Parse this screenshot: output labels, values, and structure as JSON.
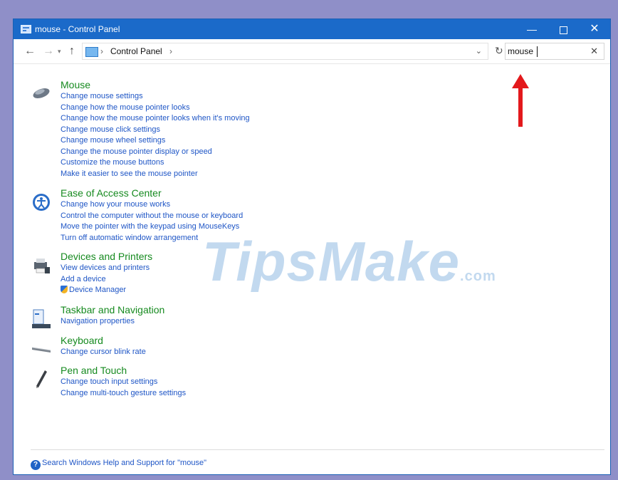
{
  "window": {
    "title": "mouse - Control Panel",
    "controls": {
      "minimize": "—",
      "close": "✕"
    }
  },
  "toolbar": {
    "back": "←",
    "forward": "→",
    "recent": "▾",
    "up": "↑",
    "breadcrumb_separator": "›",
    "breadcrumb": "Control Panel",
    "dropdown": "⌄",
    "refresh": "↻"
  },
  "search": {
    "value": "mouse",
    "clear": "✕"
  },
  "results": [
    {
      "heading": "Mouse",
      "links": [
        "Change mouse settings",
        "Change how the mouse pointer looks",
        "Change how the mouse pointer looks when it's moving",
        "Change mouse click settings",
        "Change mouse wheel settings",
        "Change the mouse pointer display or speed",
        "Customize the mouse buttons",
        "Make it easier to see the mouse pointer"
      ]
    },
    {
      "heading": "Ease of Access Center",
      "links": [
        "Change how your mouse works",
        "Control the computer without the mouse or keyboard",
        "Move the pointer with the keypad using MouseKeys",
        "Turn off automatic window arrangement"
      ]
    },
    {
      "heading": "Devices and Printers",
      "links": [
        "View devices and printers",
        "Add a device",
        "Device Manager"
      ]
    },
    {
      "heading": "Taskbar and Navigation",
      "links": [
        "Navigation properties"
      ]
    },
    {
      "heading": "Keyboard",
      "links": [
        "Change cursor blink rate"
      ]
    },
    {
      "heading": "Pen and Touch",
      "links": [
        "Change touch input settings",
        "Change multi-touch gesture settings"
      ]
    }
  ],
  "help": {
    "icon": "?",
    "text": "Search Windows Help and Support for \"mouse\""
  },
  "watermark": {
    "brand": "TipsMake",
    "suffix": ".com"
  },
  "colors": {
    "titlebar": "#1b6ac9",
    "heading": "#168a1f",
    "link": "#1f56c6",
    "arrow": "#e3191c"
  }
}
